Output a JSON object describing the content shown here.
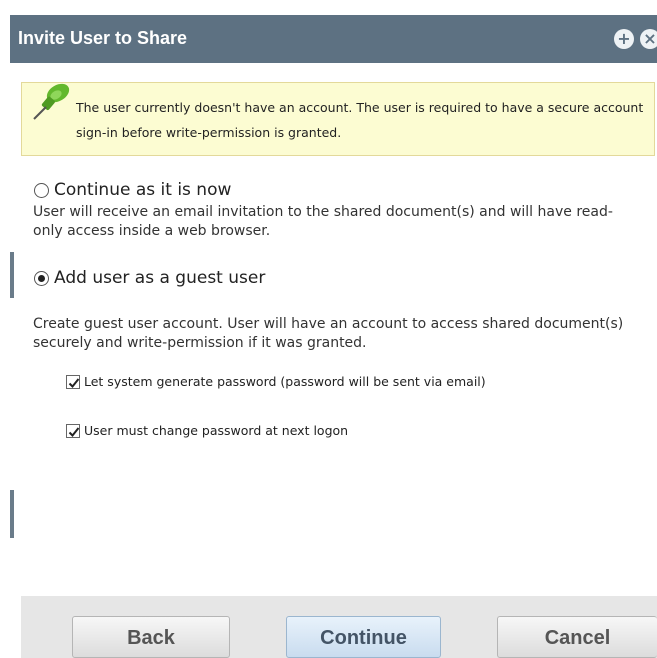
{
  "dialog": {
    "title": "Invite User to Share",
    "icons": {
      "add": "plus-circle-icon",
      "close": "close-circle-icon"
    },
    "colors": {
      "titlebar": "#5d7182",
      "notice_bg": "#fcfcd2",
      "footer_bg": "#e6e6e6"
    }
  },
  "notice": {
    "icon": "pushpin-icon",
    "text": "The user currently doesn't have an account. The user is required to have a secure account sign-in before write-permission is granted."
  },
  "options": {
    "continue": {
      "label": "Continue as it is now",
      "checked": false,
      "description": "User will receive an email invitation to the shared document(s) and will have read-only access inside a web browser."
    },
    "guest": {
      "label": "Add user as a guest user",
      "checked": true,
      "description": "Create guest user account. User will have an account to access shared document(s) securely and write-permission if it was granted."
    }
  },
  "checkboxes": {
    "generate_password": {
      "label": "Let system generate password (password will be sent via email)",
      "checked": true
    },
    "change_password": {
      "label": "User must change password at next logon",
      "checked": true
    }
  },
  "buttons": {
    "back": "Back",
    "continue": "Continue",
    "cancel": "Cancel"
  }
}
